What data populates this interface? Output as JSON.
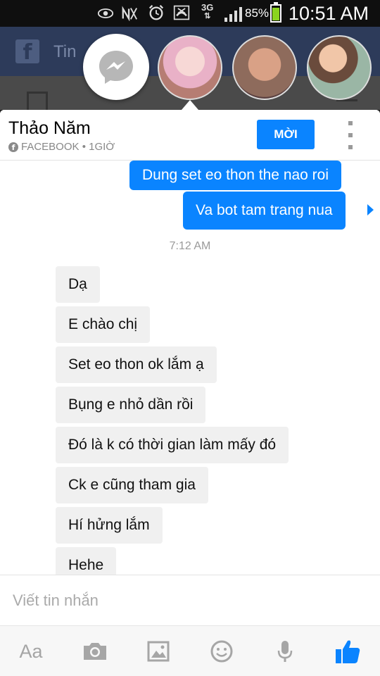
{
  "status_bar": {
    "battery_percent": "85%",
    "battery_level": 0.85,
    "time": "10:51 AM",
    "network": "3G",
    "icons": [
      "eye-icon",
      "no-signal-icon",
      "alarm-icon",
      "missed-call-icon",
      "network-3g-icon",
      "signal-icon",
      "battery-icon"
    ]
  },
  "background_app": {
    "logo": "f",
    "title": "Tin"
  },
  "chat_heads": {
    "items": [
      "messenger-icon",
      "contact-avatar",
      "contact-avatar",
      "contact-avatar"
    ]
  },
  "header": {
    "contact_name": "Thảo Năm",
    "source_meta": "FACEBOOK • 1GIỜ",
    "invite_label": "MỜI",
    "fb_glyph": "f"
  },
  "messages": {
    "outgoing": [
      "Dung set eo thon the nao roi",
      "Va bot tam trang nua"
    ],
    "timestamp": "7:12 AM",
    "incoming": [
      "Dạ",
      "E chào chị",
      "Set eo thon ok lắm ạ",
      "Bụng e nhỏ dần rồi",
      "Đó là k có thời gian làm mấy đó",
      "Ck e cũng tham gia",
      "Hí hửng lắm",
      "Hehe"
    ]
  },
  "composer": {
    "placeholder": "Viết tin nhắn",
    "value": ""
  },
  "toolbar": {
    "text_format_label": "Aa",
    "accent_color": "#0a84ff"
  }
}
